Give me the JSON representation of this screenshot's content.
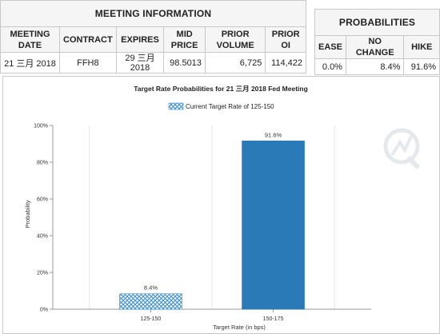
{
  "meeting_info": {
    "title": "MEETING INFORMATION",
    "headers": {
      "meeting_date": "MEETING DATE",
      "contract": "CONTRACT",
      "expires": "EXPIRES",
      "mid_price": "MID PRICE",
      "prior_volume": "PRIOR VOLUME",
      "prior_oi": "PRIOR OI"
    },
    "row": {
      "meeting_date": "21 三月 2018",
      "contract": "FFH8",
      "expires": "29 三月 2018",
      "mid_price": "98.5013",
      "prior_volume": "6,725",
      "prior_oi": "114,422"
    }
  },
  "probabilities": {
    "title": "PROBABILITIES",
    "headers": {
      "ease": "EASE",
      "no_change": "NO CHANGE",
      "hike": "HIKE"
    },
    "row": {
      "ease": "0.0%",
      "no_change": "8.4%",
      "hike": "91.6%"
    }
  },
  "colors": {
    "bar_current": "#2a7ab8",
    "bar_hatch": "#3a8fd0",
    "axis": "#999999",
    "grid": "#e6e6e6"
  },
  "chart_data": {
    "type": "bar",
    "title": "Target Rate Probabilities for 21 三月 2018 Fed Meeting",
    "legend": "Current Target Rate of 125-150",
    "legend_position": "top-center",
    "xlabel": "Target Rate (in bps)",
    "ylabel": "Probability",
    "categories": [
      "125-150",
      "150-175"
    ],
    "values": [
      8.4,
      91.6
    ],
    "data_labels": [
      "8.4%",
      "91.6%"
    ],
    "current_category": "125-150",
    "ylim": [
      0,
      100
    ],
    "yticks": [
      "0%",
      "20%",
      "40%",
      "60%",
      "80%",
      "100%"
    ],
    "grid": "vertical"
  }
}
